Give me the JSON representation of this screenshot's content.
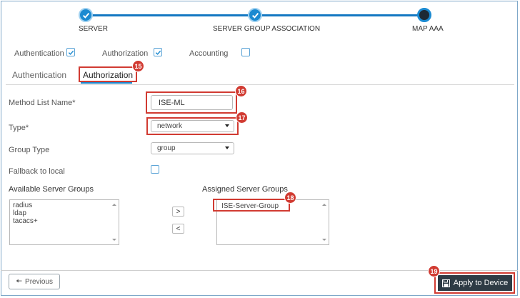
{
  "wizard": {
    "steps": [
      {
        "label": "SERVER",
        "state": "done"
      },
      {
        "label": "SERVER GROUP ASSOCIATION",
        "state": "done"
      },
      {
        "label": "MAP AAA",
        "state": "current"
      }
    ]
  },
  "options": {
    "authentication": {
      "label": "Authentication",
      "checked": true
    },
    "authorization": {
      "label": "Authorization",
      "checked": true
    },
    "accounting": {
      "label": "Accounting",
      "checked": false
    }
  },
  "tabs": [
    {
      "label": "Authentication",
      "active": false
    },
    {
      "label": "Authorization",
      "active": true
    }
  ],
  "form": {
    "method_list_name": {
      "label": "Method List Name*",
      "value": "ISE-ML"
    },
    "type": {
      "label": "Type*",
      "value": "network"
    },
    "group_type": {
      "label": "Group Type",
      "value": "group"
    },
    "fallback": {
      "label": "Fallback to local",
      "checked": false
    }
  },
  "server_groups": {
    "available_label": "Available Server Groups",
    "available": [
      "radius",
      "ldap",
      "tacacs+"
    ],
    "assigned_label": "Assigned Server Groups",
    "assigned": [
      "ISE-Server-Group"
    ],
    "move_right": ">",
    "move_left": "<"
  },
  "callouts": [
    "15",
    "16",
    "17",
    "18",
    "19"
  ],
  "footer": {
    "previous": "Previous",
    "apply": "Apply to Device"
  },
  "colors": {
    "accent": "#1b8ad1",
    "callout_red": "#d13b32",
    "apply_bg": "#2e3b45"
  }
}
